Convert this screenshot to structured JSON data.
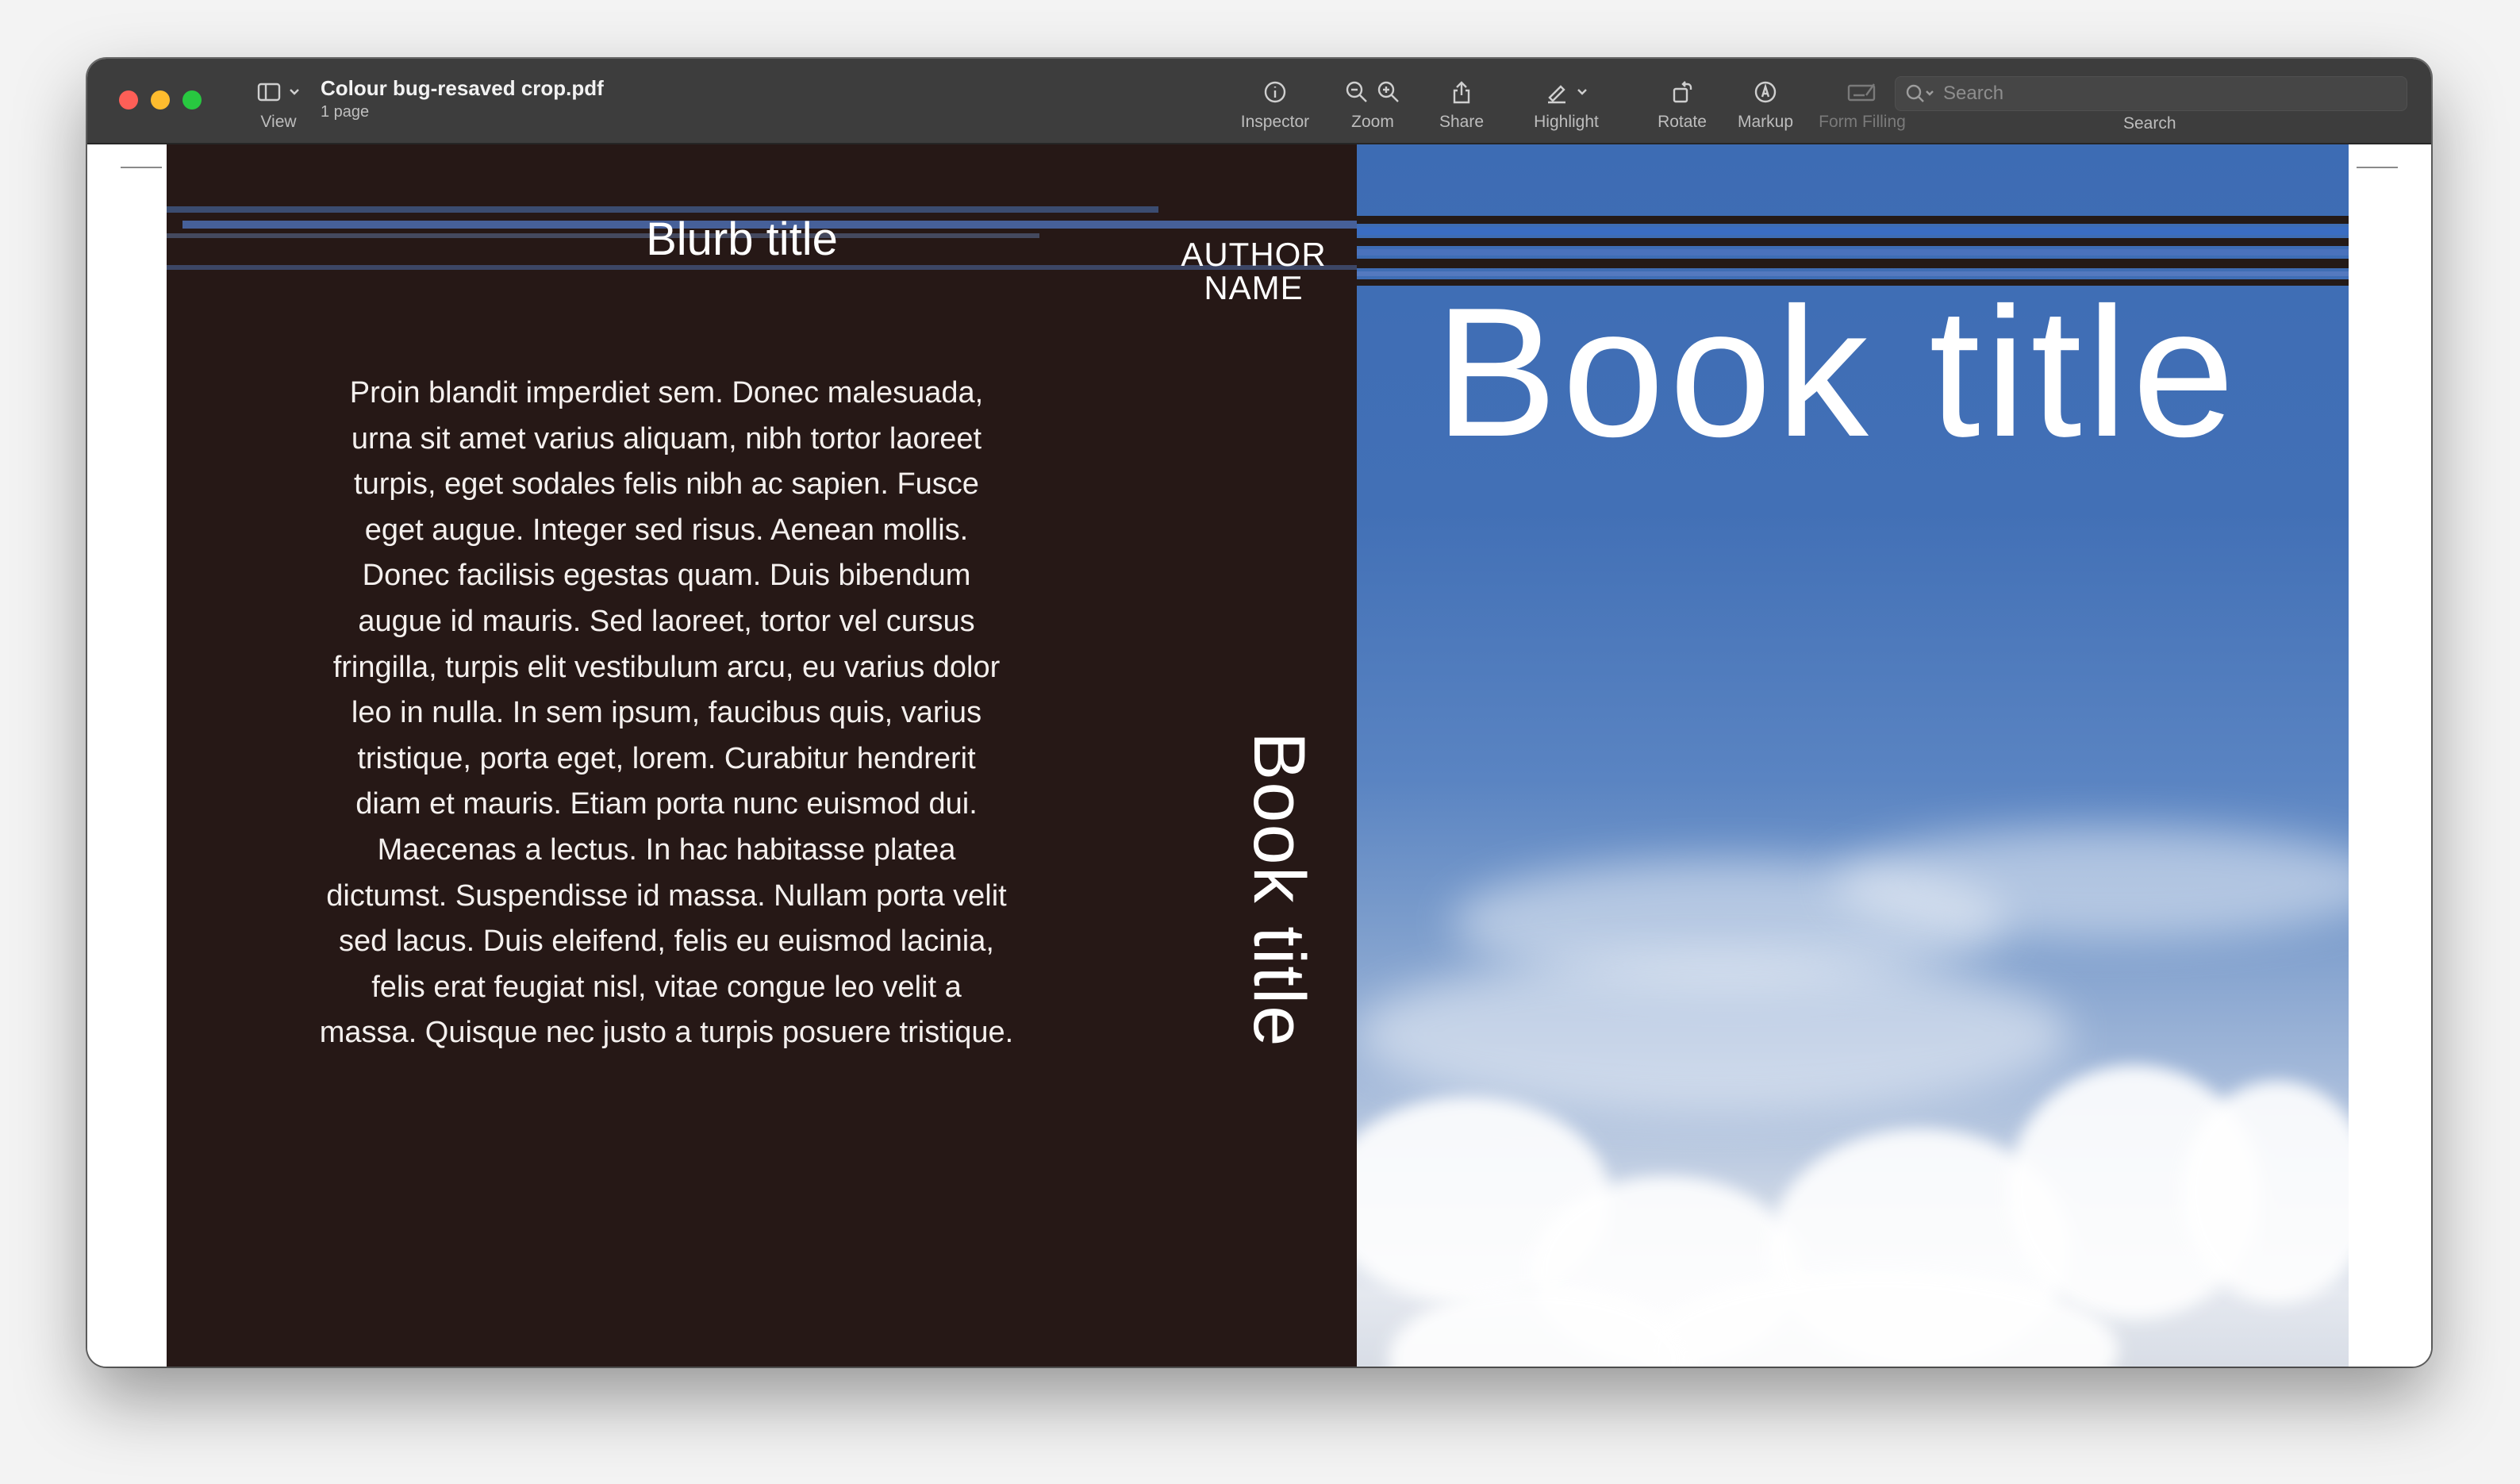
{
  "window": {
    "doc_title": "Colour bug-resaved crop.pdf",
    "doc_subtitle": "1 page"
  },
  "toolbar": {
    "view_label": "View",
    "inspector_label": "Inspector",
    "zoom_label": "Zoom",
    "share_label": "Share",
    "highlight_label": "Highlight",
    "rotate_label": "Rotate",
    "markup_label": "Markup",
    "form_filling_label": "Form Filling",
    "search_label": "Search",
    "search_placeholder": "Search"
  },
  "cover": {
    "blurb_title": "Blurb title",
    "author_line1": "AUTHOR",
    "author_line2": "NAME",
    "blurb_lines": [
      "Proin blandit imperdiet sem. Donec malesuada,",
      "urna sit amet varius aliquam, nibh tortor laoreet",
      "turpis, eget sodales felis  nibh ac sapien. Fusce",
      "eget augue. Integer sed risus. Aenean mollis.",
      "Donec facilisis egestas quam. Duis bibendum",
      "augue  id mauris. Sed laoreet, tortor vel cursus",
      "fringilla, turpis elit vestibulum arcu, eu varius dolor",
      "leo in nulla. In sem ipsum, faucibus quis, varius",
      "tristique, porta eget, lorem. Curabitur hendrerit",
      "diam et mauris. Etiam porta nunc euismod dui.",
      "Maecenas a lectus. In hac habitasse platea",
      "dictumst. Suspendisse id massa. Nullam porta velit",
      "sed lacus. Duis eleifend, felis eu euismod lacinia,",
      "felis erat feugiat nisl, vitae congue leo velit a",
      "massa. Quisque nec justo a turpis posuere tristique."
    ],
    "spine_title": "Book title",
    "front_title": "Book title"
  },
  "colors": {
    "back_cover": "#261816",
    "sky_top": "#3d6cb4",
    "toolbar_bg": "#3d3d3d"
  }
}
